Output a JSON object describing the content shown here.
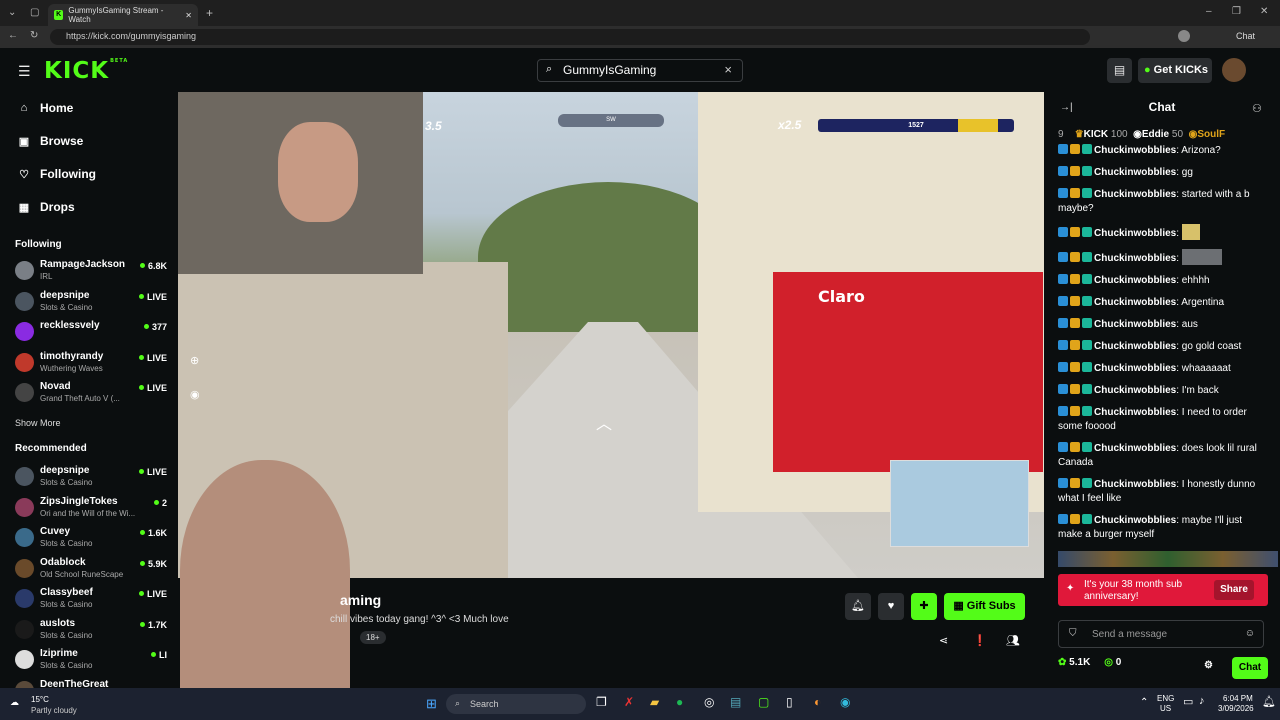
{
  "browser": {
    "tab_title": "GummyIsGaming Stream - Watch",
    "url": "https://kick.com/gummyisgaming",
    "copilot_label": "Chat"
  },
  "header": {
    "logo": "KICK",
    "logo_badge": "BETA",
    "search_value": "GummyIsGaming",
    "get_kicks_label": "Get KICKs"
  },
  "sidebar": {
    "nav": [
      {
        "label": "Home",
        "icon": "home-icon"
      },
      {
        "label": "Browse",
        "icon": "browse-icon"
      },
      {
        "label": "Following",
        "icon": "heart-icon"
      },
      {
        "label": "Drops",
        "icon": "gift-icon"
      }
    ],
    "following_heading": "Following",
    "following": [
      {
        "name": "RampageJackson",
        "category": "IRL",
        "viewers": "6.8K",
        "color": "#7a7f86"
      },
      {
        "name": "deepsnipe",
        "category": "Slots & Casino",
        "viewers": "LIVE",
        "color": "#4b5560"
      },
      {
        "name": "recklessvely",
        "category": "",
        "viewers": "377",
        "color": "#8a2be2"
      },
      {
        "name": "timothyrandy",
        "category": "Wuthering Waves",
        "viewers": "LIVE",
        "color": "#c0392b"
      },
      {
        "name": "Novad",
        "category": "Grand Theft Auto V (...",
        "viewers": "LIVE",
        "color": "#444444"
      }
    ],
    "show_more": "Show More",
    "recommended_heading": "Recommended",
    "recommended": [
      {
        "name": "deepsnipe",
        "category": "Slots & Casino",
        "viewers": "LIVE",
        "color": "#4b5560"
      },
      {
        "name": "ZipsJingleTokes",
        "category": "Ori and the Will of the Wi...",
        "viewers": "2",
        "color": "#8a3a5a"
      },
      {
        "name": "Cuvey",
        "category": "Slots & Casino",
        "viewers": "1.6K",
        "color": "#3a6a8a"
      },
      {
        "name": "Odablock",
        "category": "Old School RuneScape",
        "viewers": "5.9K",
        "color": "#6a4a2a"
      },
      {
        "name": "Classybeef",
        "category": "Slots & Casino",
        "viewers": "LIVE",
        "color": "#2a3a6a"
      },
      {
        "name": "auslots",
        "category": "Slots & Casino",
        "viewers": "1.7K",
        "color": "#1a1a1a"
      },
      {
        "name": "Iziprime",
        "category": "Slots & Casino",
        "viewers": "LI",
        "color": "#dddddd"
      },
      {
        "name": "DeenTheGreat",
        "category": "",
        "viewers": "",
        "color": "#5a4a3a"
      }
    ]
  },
  "video": {
    "compass": "SW",
    "multiplier_left": "3.5",
    "multiplier_right": "x2.5",
    "score": "1527",
    "shop_sign": "Claro"
  },
  "stream": {
    "title": "aming",
    "subtitle": "chill vibes today gang! ^3^  <3 Much love",
    "badge": "18+",
    "gift_subs_label": "Gift Subs"
  },
  "chat": {
    "title": "Chat",
    "leaderboard": [
      {
        "rank": "9",
        "name": "",
        "value": ""
      },
      {
        "rank": "",
        "name": "KICK",
        "value": "100"
      },
      {
        "rank": "",
        "name": "Eddie",
        "value": "50"
      },
      {
        "rank": "",
        "name": "SoulF",
        "value": ""
      }
    ],
    "messages": [
      {
        "user": "Chuckinwobblies",
        "text": "Arizona?",
        "emote": ""
      },
      {
        "user": "Chuckinwobblies",
        "text": "gg",
        "emote": ""
      },
      {
        "user": "Chuckinwobblies",
        "text": "started with a b maybe?",
        "emote": ""
      },
      {
        "user": "Chuckinwobblies",
        "text": "",
        "emote": "small"
      },
      {
        "user": "Chuckinwobblies",
        "text": "",
        "emote": "wide"
      },
      {
        "user": "Chuckinwobblies",
        "text": "ehhhh",
        "emote": ""
      },
      {
        "user": "Chuckinwobblies",
        "text": "Argentina",
        "emote": ""
      },
      {
        "user": "Chuckinwobblies",
        "text": "aus",
        "emote": ""
      },
      {
        "user": "Chuckinwobblies",
        "text": "go gold coast",
        "emote": ""
      },
      {
        "user": "Chuckinwobblies",
        "text": "whaaaaaat",
        "emote": ""
      },
      {
        "user": "Chuckinwobblies",
        "text": "I'm back",
        "emote": ""
      },
      {
        "user": "Chuckinwobblies",
        "text": "I need to order some fooood",
        "emote": ""
      },
      {
        "user": "Chuckinwobblies",
        "text": "does look lil rural Canada",
        "emote": ""
      },
      {
        "user": "Chuckinwobblies",
        "text": "I honestly dunno what I feel like",
        "emote": ""
      },
      {
        "user": "Chuckinwobblies",
        "text": "maybe I'll just make a burger myself",
        "emote": ""
      }
    ],
    "anniversary_text": "It's your 38 month sub anniversary!",
    "share_label": "Share",
    "input_placeholder": "Send a message",
    "points": "5.1K",
    "kicks": "0",
    "chat_button": "Chat"
  },
  "taskbar": {
    "weather_temp": "15°C",
    "weather_desc": "Partly cloudy",
    "search_label": "Search",
    "lang_top": "ENG",
    "lang_bottom": "US",
    "time": "6:04 PM",
    "date": "3/09/2026"
  },
  "colors": {
    "accent": "#53fc18",
    "anniversary": "#e0183a",
    "background": "#0b0e0f"
  }
}
